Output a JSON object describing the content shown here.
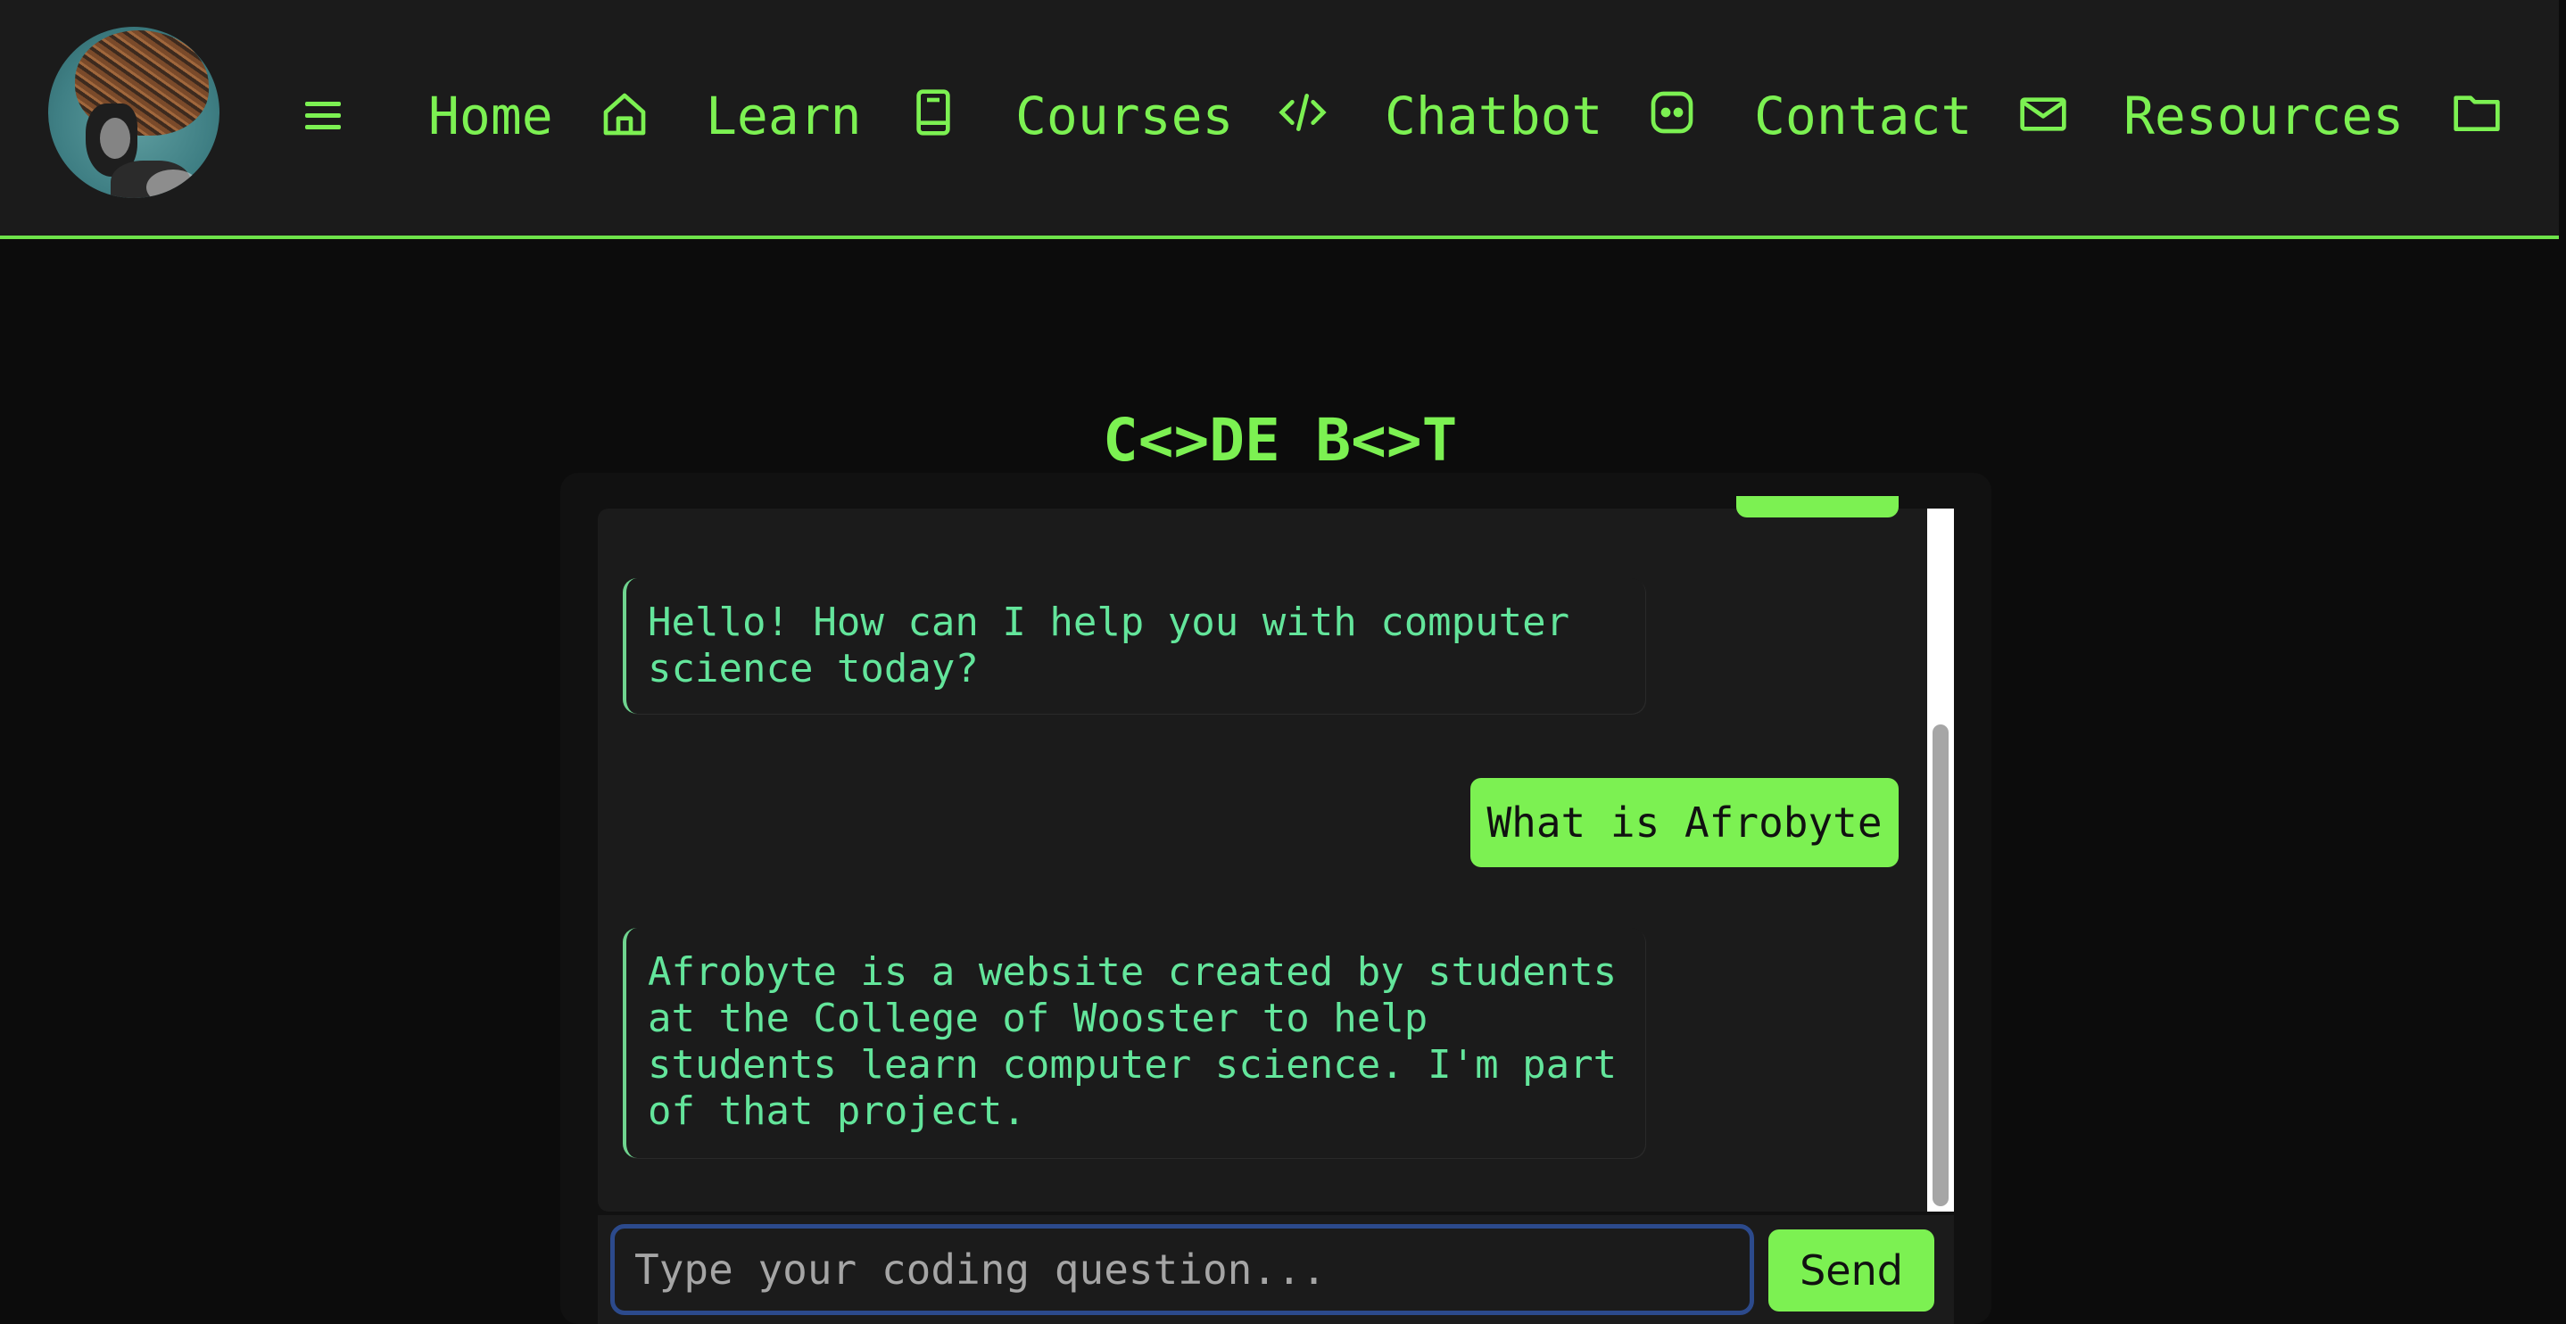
{
  "nav": {
    "menu_icon": "hamburger-icon",
    "items": [
      {
        "label": "Home",
        "icon": "home-icon"
      },
      {
        "label": "Learn",
        "icon": "book-icon"
      },
      {
        "label": "Courses",
        "icon": "code-icon"
      },
      {
        "label": "Chatbot",
        "icon": "chat-bot-icon"
      },
      {
        "label": "Contact",
        "icon": "mail-icon"
      },
      {
        "label": "Resources",
        "icon": "folder-icon"
      }
    ],
    "accent_color": "#7cf152",
    "background_color": "#1b1b1b"
  },
  "chat": {
    "title": "C<>DE B<>T",
    "messages": [
      {
        "role": "bot",
        "text": "Hello! How can I help you with computer science today?"
      },
      {
        "role": "user",
        "text": "What is Afrobyte"
      },
      {
        "role": "bot",
        "text": "Afrobyte is a website created by students at the College of Wooster to help students learn computer science. I'm part of that project."
      }
    ],
    "input_placeholder": "Type your coding question...",
    "input_value": "",
    "send_label": "Send",
    "bot_text_color": "#63e59b",
    "user_bubble_color": "#7cf152"
  }
}
